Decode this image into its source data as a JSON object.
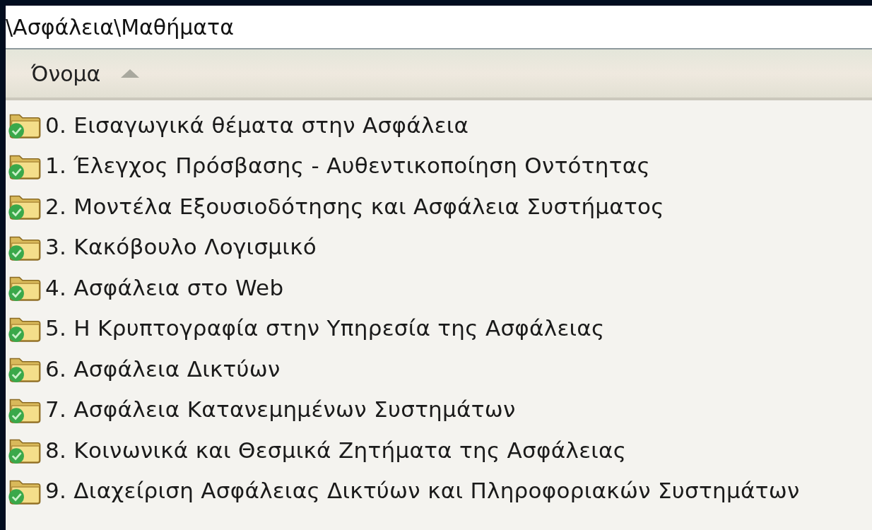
{
  "address_bar": {
    "path": "\\Ασφάλεια\\Μαθήματα"
  },
  "list_header": {
    "column": "Όνομα",
    "sorted": true,
    "ascending": true
  },
  "items": [
    {
      "name": "0. Εισαγωγικά θέματα στην Ασφάλεια"
    },
    {
      "name": "1. Έλεγχος Πρόσβασης - Αυθεντικοποίηση Οντότητας"
    },
    {
      "name": "2. Μοντέλα Εξουσιοδότησης και Ασφάλεια Συστήματος"
    },
    {
      "name": "3. Κακόβουλο Λογισμικό"
    },
    {
      "name": "4. Ασφάλεια στο Web"
    },
    {
      "name": "5. Η Κρυπτογραφία στην Υπηρεσία της Ασφάλειας"
    },
    {
      "name": "6. Ασφάλεια Δικτύων"
    },
    {
      "name": "7. Ασφάλεια Κατανεμημένων Συστημάτων"
    },
    {
      "name": "8. Κοινωνικά και Θεσμικά Ζητήματα της Ασφάλειας"
    },
    {
      "name": "9. Διαχείριση Ασφάλειας Δικτύων και Πληροφοριακών Συστημάτων"
    }
  ]
}
